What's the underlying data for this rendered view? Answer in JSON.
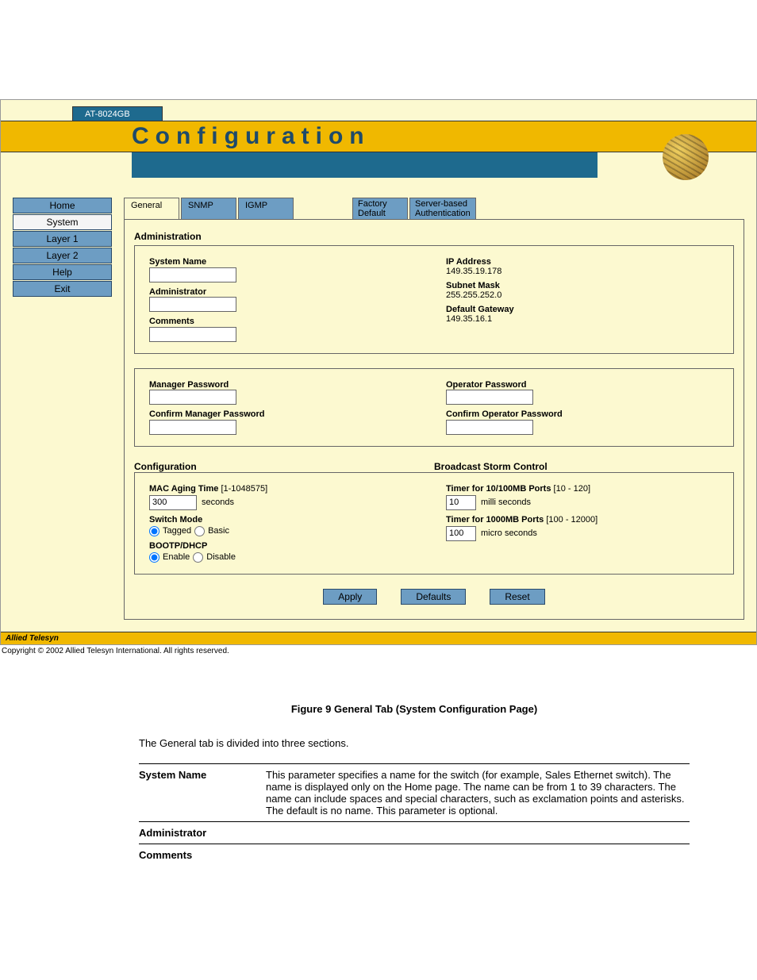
{
  "model": "AT-8024GB",
  "title": "Configuration",
  "nav": [
    "Home",
    "System",
    "Layer 1",
    "Layer 2",
    "Help",
    "Exit"
  ],
  "tabs": {
    "general": "General",
    "snmp": "SNMP",
    "igmp": "IGMP",
    "factory": "Factory\nDefault",
    "server": "Server-based\nAuthentication"
  },
  "admin": {
    "heading": "Administration",
    "system_name": "System Name",
    "administrator": "Administrator",
    "comments": "Comments",
    "ip_label": "IP Address",
    "ip": "149.35.19.178",
    "subnet_label": "Subnet Mask",
    "subnet": "255.255.252.0",
    "gateway_label": "Default Gateway",
    "gateway": "149.35.16.1"
  },
  "passwords": {
    "manager": "Manager Password",
    "confirm_manager": "Confirm Manager Password",
    "operator": "Operator Password",
    "confirm_operator": "Confirm Operator Password"
  },
  "config": {
    "heading": "Configuration",
    "mac_label": "MAC Aging Time",
    "mac_range": "[1-1048575]",
    "mac_value": "300",
    "seconds": "seconds",
    "switch_mode": "Switch Mode",
    "tagged": "Tagged",
    "basic": "Basic",
    "bootp": "BOOTP/DHCP",
    "enable": "Enable",
    "disable": "Disable"
  },
  "storm": {
    "heading": "Broadcast Storm Control",
    "t1_label": "Timer for 10/100MB Ports",
    "t1_range": "[10 - 120]",
    "t1_value": "10",
    "t1_unit": "milli seconds",
    "t2_label": "Timer for 1000MB Ports",
    "t2_range": "[100 - 12000]",
    "t2_value": "100",
    "t2_unit": "micro seconds"
  },
  "buttons": {
    "apply": "Apply",
    "defaults": "Defaults",
    "reset": "Reset"
  },
  "footer": {
    "logo": "Allied Telesyn",
    "copyright": "Copyright © 2002 Allied Telesyn International. All rights reserved."
  },
  "figure": {
    "caption": "Figure 9  General Tab (System Configuration Page)",
    "intro": "The General tab is divided into three sections.",
    "rows": [
      {
        "term": "System Name",
        "def": "This parameter specifies a name for the switch (for example, Sales Ethernet switch). The name is displayed only on the Home page. The name can be from 1 to 39 characters. The name can include spaces and special characters, such as exclamation points and asterisks. The default is no name. This parameter is optional."
      },
      {
        "term": "Administrator",
        "def": ""
      },
      {
        "term": "Comments",
        "def": ""
      }
    ]
  }
}
